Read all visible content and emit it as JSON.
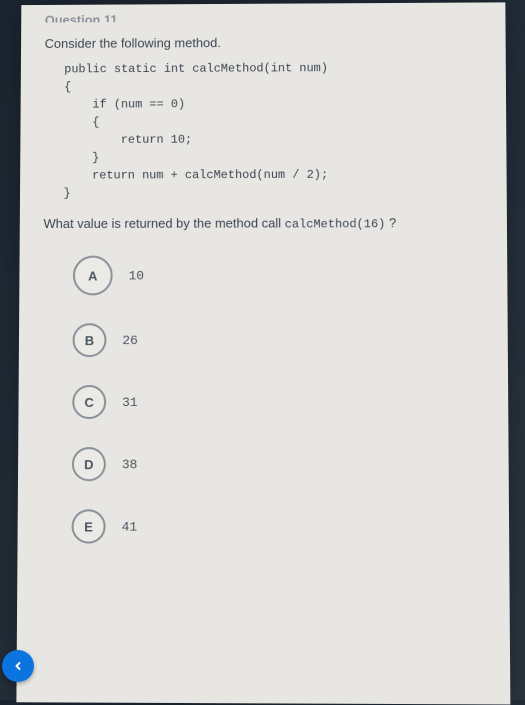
{
  "header_cut": "Question 11",
  "prompt": "Consider the following method.",
  "code": "public static int calcMethod(int num)\n{\n    if (num == 0)\n    {\n        return 10;\n    }\n    return num + calcMethod(num / 2);\n}",
  "question_pre": "What value is returned by the method call ",
  "question_code": "calcMethod(16)",
  "question_post": " ?",
  "options": [
    {
      "letter": "A",
      "text": "10",
      "emph": true
    },
    {
      "letter": "B",
      "text": "26",
      "emph": false
    },
    {
      "letter": "C",
      "text": "31",
      "emph": false
    },
    {
      "letter": "D",
      "text": "38",
      "emph": false
    },
    {
      "letter": "E",
      "text": "41",
      "emph": false
    }
  ],
  "nav_prev_label": "Previous"
}
